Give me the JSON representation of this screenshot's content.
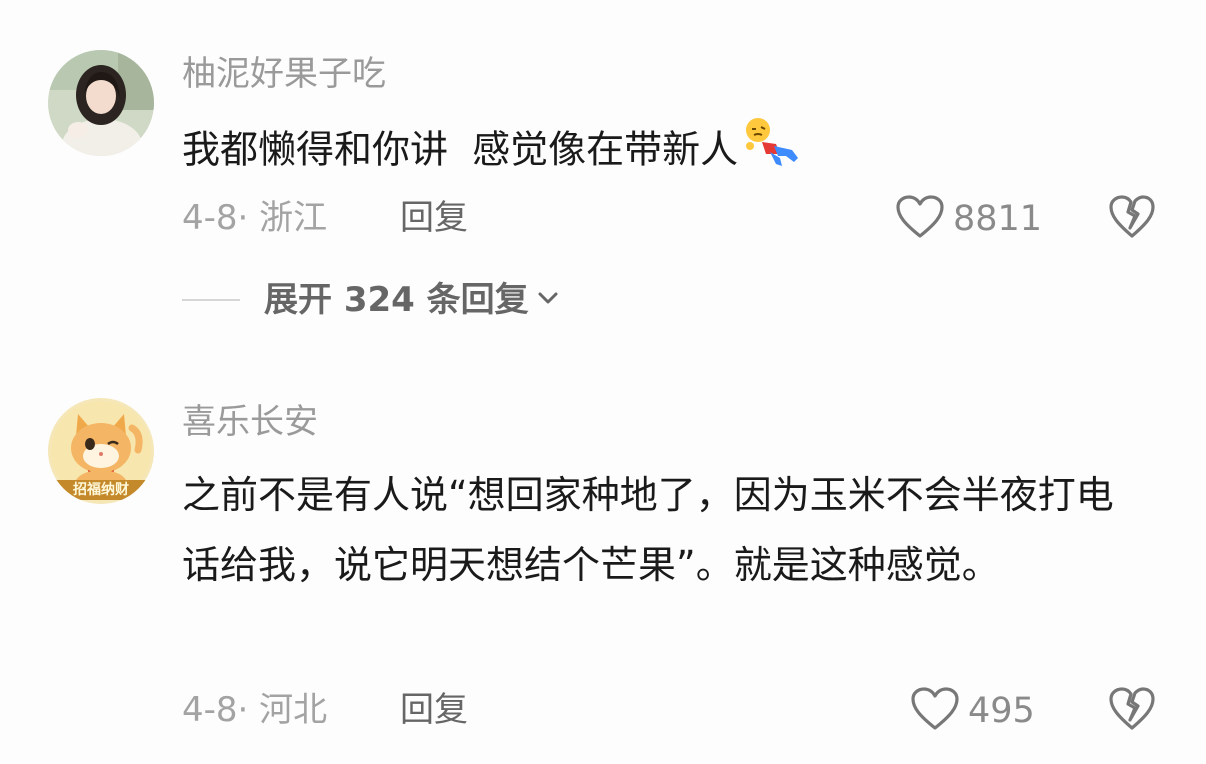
{
  "comments": [
    {
      "username": "柚泥好果子吃",
      "text": "我都懒得和你讲  感觉像在带新人",
      "emoji": "lying-down-emoji",
      "meta": "4-8· 浙江",
      "reply_label": "回复",
      "likes": "8811",
      "expand_replies": "展开 324 条回复"
    },
    {
      "username": "喜乐长安",
      "text": "之前不是有人说“想回家种地了，因为玉米不会半夜打电话给我，说它明天想结个芒果”。就是这种感觉。",
      "avatar_badge": "招福纳财",
      "meta": "4-8· 河北",
      "reply_label": "回复",
      "likes": "495"
    }
  ],
  "colors": {
    "background": "#fdfdfd",
    "username": "#9a9a9a",
    "content": "#1a1a1a",
    "meta": "#a3a3a3",
    "icon": "#777777"
  },
  "icons": {
    "like": "heart-outline-icon",
    "dislike": "broken-heart-icon",
    "expand": "chevron-down-icon"
  }
}
